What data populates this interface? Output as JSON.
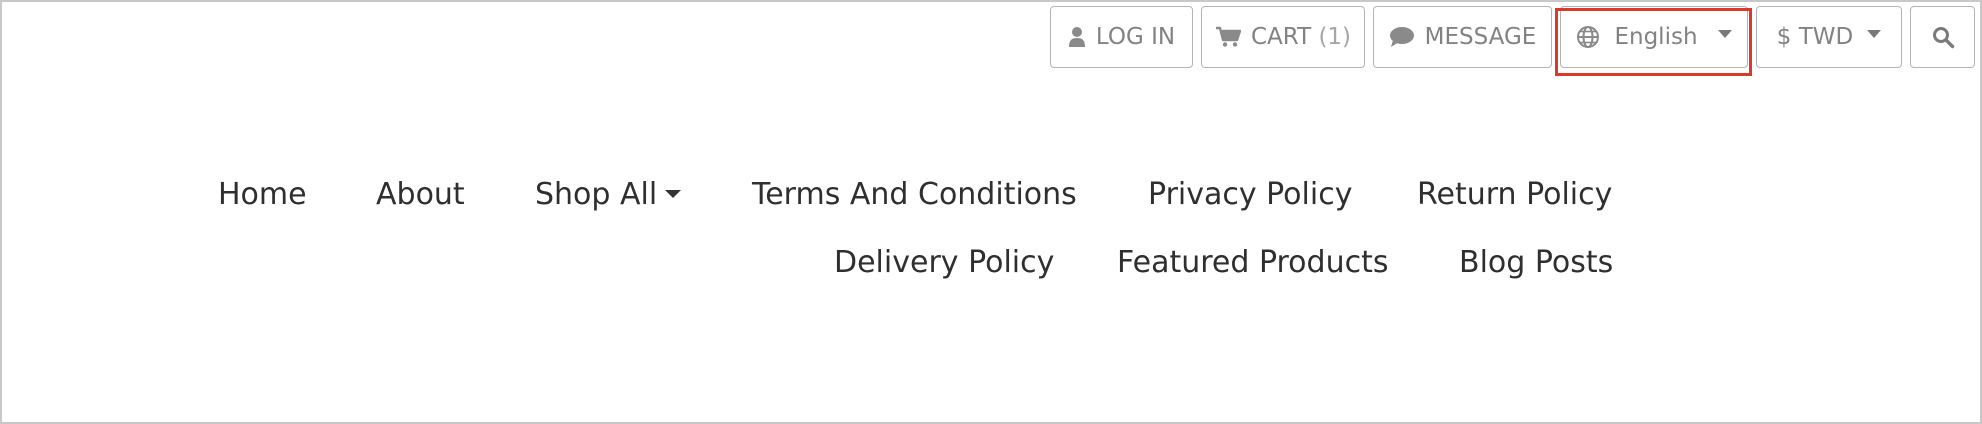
{
  "topbar": {
    "login": {
      "icon": "user-icon",
      "label": "LOG IN"
    },
    "cart": {
      "icon": "cart-icon",
      "label": "CART",
      "count": "(1)"
    },
    "message": {
      "icon": "chat-bubble-icon",
      "label": "MESSAGE"
    },
    "language": {
      "icon": "globe-icon",
      "selected": "English"
    },
    "currency": {
      "selected": "$ TWD"
    },
    "search": {
      "icon": "search-icon"
    }
  },
  "nav": {
    "items": [
      {
        "label": "Home"
      },
      {
        "label": "About"
      },
      {
        "label": "Shop All",
        "has_dropdown": true
      },
      {
        "label": "Terms And Conditions"
      },
      {
        "label": "Privacy Policy"
      },
      {
        "label": "Return Policy"
      },
      {
        "label": "Delivery Policy"
      },
      {
        "label": "Featured Products"
      },
      {
        "label": "Blog Posts"
      }
    ]
  },
  "colors": {
    "highlight_border": "#d93a2b",
    "button_border": "#b4b4b4",
    "button_text": "#828282",
    "nav_text": "#2f2f2f",
    "page_border": "#c8c8c8"
  }
}
